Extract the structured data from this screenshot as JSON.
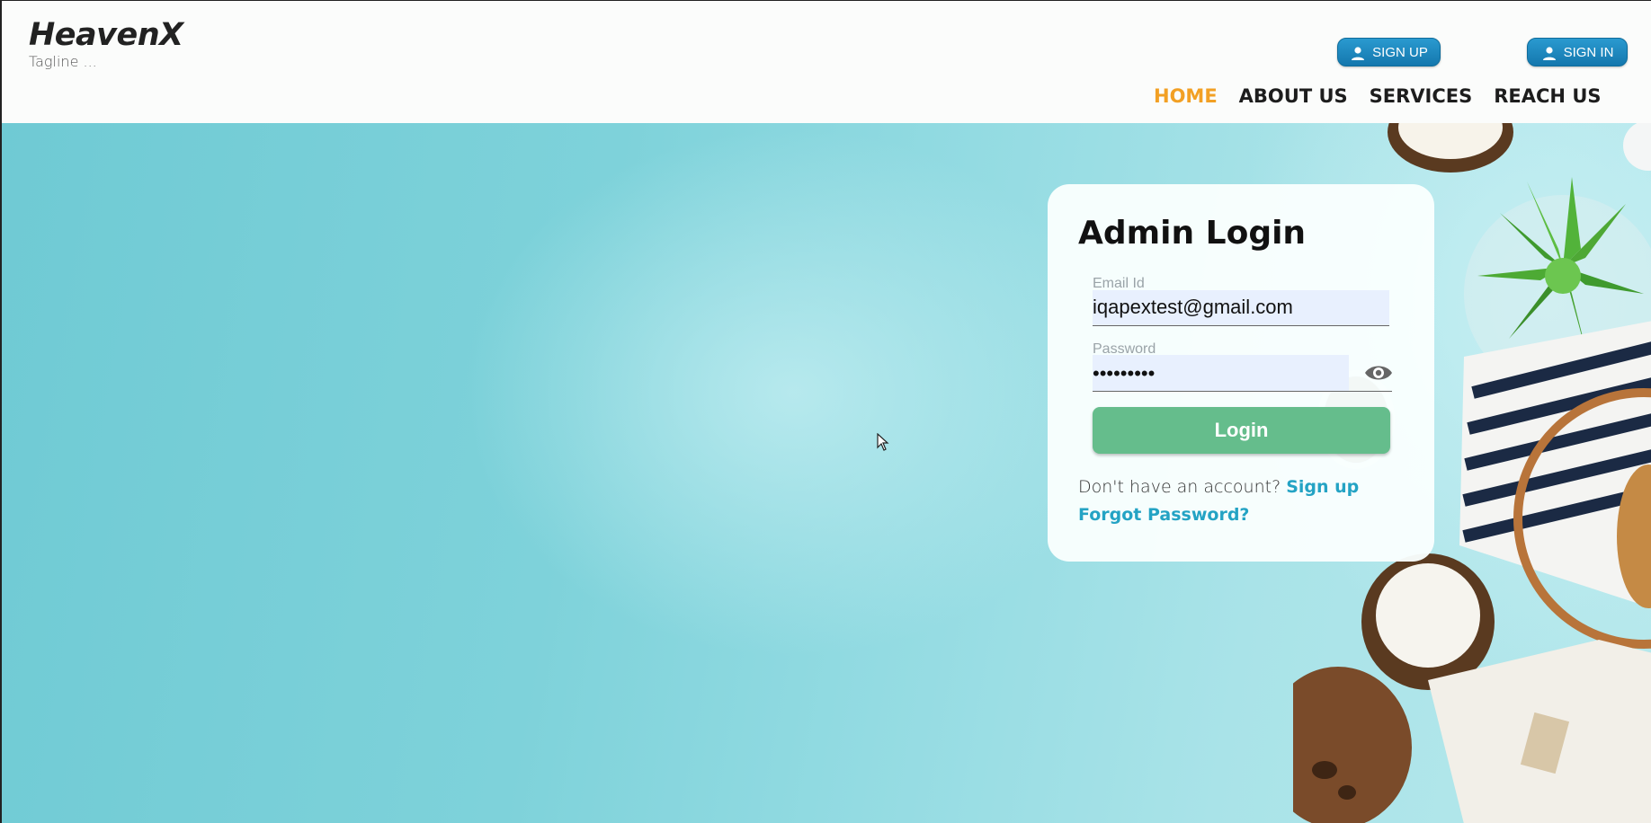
{
  "brand": {
    "name": "HeavenX",
    "tagline": "Tagline ..."
  },
  "header_buttons": {
    "signup_label": "SIGN UP",
    "signin_label": "SIGN IN",
    "icon": "person-icon"
  },
  "nav": {
    "items": [
      {
        "label": "HOME",
        "active": true
      },
      {
        "label": "ABOUT US",
        "active": false
      },
      {
        "label": "SERVICES",
        "active": false
      },
      {
        "label": "REACH US",
        "active": false
      }
    ]
  },
  "login": {
    "title": "Admin Login",
    "email_label": "Email Id",
    "email_value": "iqapextest@gmail.com",
    "password_label": "Password",
    "password_value": "•••••••••",
    "toggle_icon": "eye-icon",
    "button_label": "Login",
    "no_account_text": "Don't have an account?",
    "signup_link": "Sign up",
    "forgot_link": "Forgot Password?"
  },
  "colors": {
    "accent_nav_active": "#f2a024",
    "header_button": "#1a86bf",
    "login_button": "#65bd8c",
    "link": "#24a3c4",
    "hero_background": "#7ed2da"
  }
}
